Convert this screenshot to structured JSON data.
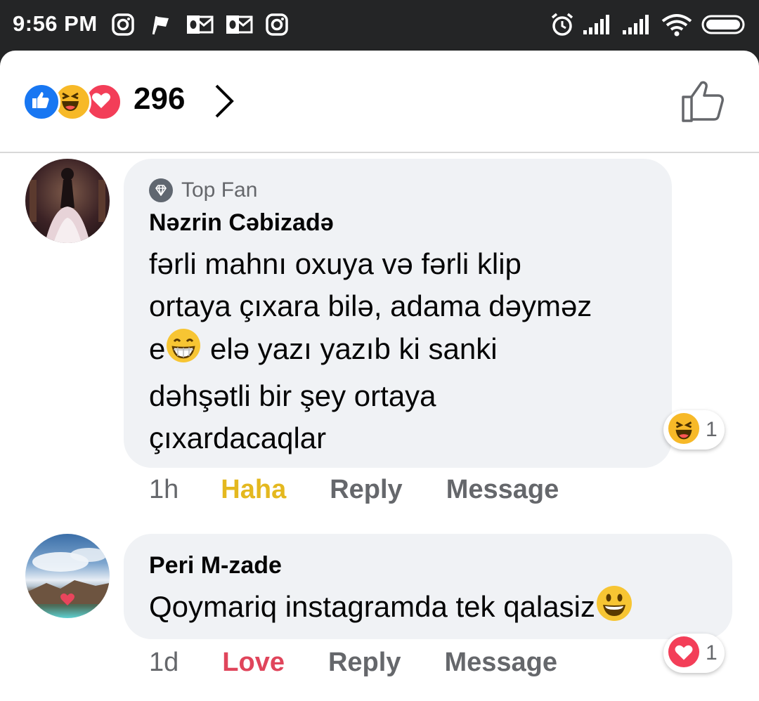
{
  "status_bar": {
    "time": "9:56 PM",
    "left_icons": [
      "instagram-icon",
      "flag-icon",
      "outlook-icon",
      "outlook-icon",
      "instagram-icon"
    ],
    "right_icons": [
      "alarm-icon",
      "signal-icon",
      "signal-icon",
      "wifi-icon",
      "battery-icon"
    ]
  },
  "reactions": {
    "icons": [
      "like",
      "haha",
      "love"
    ],
    "count": "296",
    "colors": {
      "like": "#1877f2",
      "haha": "#f7b928",
      "love": "#f33e58"
    }
  },
  "comments": [
    {
      "badge": "Top Fan",
      "author": "Nəzrin Cəbizadə",
      "lines": [
        "fərli mahnı oxuya və fərli klip",
        "ortaya çıxara bilə, adama dəyməz",
        "e",
        " elə yazı yazıb ki sanki",
        "dəhşətli bir şey ortaya",
        "çıxardacaqlar"
      ],
      "time": "1h",
      "reaction_label": "Haha",
      "reply_label": "Reply",
      "message_label": "Message",
      "reaction_chip_count": "1",
      "reaction_color": "#e4b81f"
    },
    {
      "author": "Peri M-zade",
      "text": "Qoymariq instagramda tek qalasiz",
      "time": "1d",
      "reaction_label": "Love",
      "reply_label": "Reply",
      "message_label": "Message",
      "reaction_chip_count": "1",
      "reaction_color": "#e0455b"
    }
  ]
}
